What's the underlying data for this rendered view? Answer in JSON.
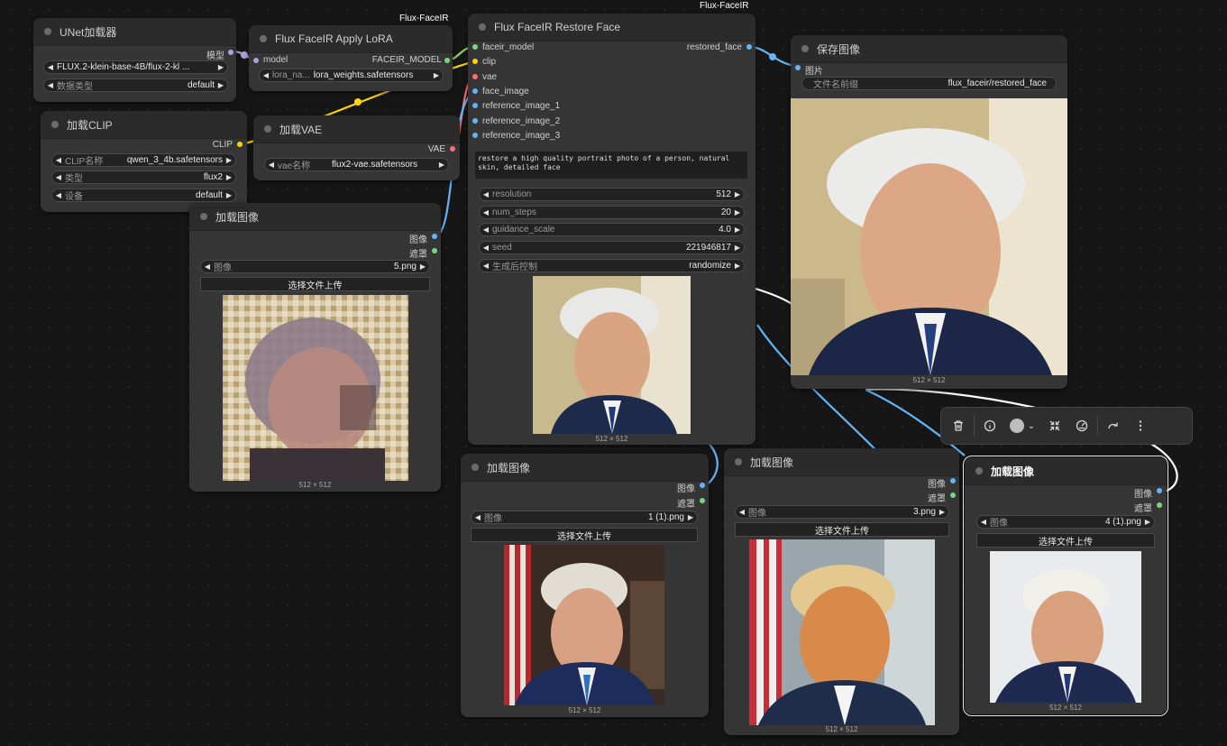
{
  "badges": {
    "lora_group": "Flux-FaceIR",
    "restore_group": "Flux-FaceIR"
  },
  "unet": {
    "title": "UNet加载器",
    "out_model": "模型",
    "unet_name": "FLUX.2-klein-base-4B/flux-2-kl ...",
    "dtype_label": "数据类型",
    "dtype_value": "default"
  },
  "lora": {
    "title": "Flux FaceIR Apply LoRA",
    "in_model": "model",
    "out_model": "FACEIR_MODEL",
    "lora_label": "lora_na...",
    "lora_value": "lora_weights.safetensors"
  },
  "clip": {
    "title": "加载CLIP",
    "out_clip": "CLIP",
    "name_label": "CLIP名称",
    "name_value": "qwen_3_4b.safetensors",
    "type_label": "类型",
    "type_value": "flux2",
    "device_label": "设备",
    "device_value": "default"
  },
  "vae": {
    "title": "加载VAE",
    "out_vae": "VAE",
    "name_label": "vae名称",
    "name_value": "flux2-vae.safetensors"
  },
  "restore": {
    "title": "Flux FaceIR Restore Face",
    "in_faceir": "faceir_model",
    "in_clip": "clip",
    "in_vae": "vae",
    "in_face": "face_image",
    "in_ref1": "reference_image_1",
    "in_ref2": "reference_image_2",
    "in_ref3": "reference_image_3",
    "out_restored": "restored_face",
    "prompt": "restore a high quality portrait photo of a person, natural skin, detailed face",
    "widgets": [
      {
        "label": "resolution",
        "value": "512"
      },
      {
        "label": "num_steps",
        "value": "20"
      },
      {
        "label": "guidance_scale",
        "value": "4.0"
      },
      {
        "label": "seed",
        "value": "221946817"
      },
      {
        "label": "生成后控制",
        "value": "randomize"
      }
    ],
    "dims": "512 × 512"
  },
  "save": {
    "title": "保存图像",
    "in_images": "图片",
    "prefix_label": "文件名前缀",
    "prefix_value": "flux_faceir/restored_face",
    "dims": "512 × 512"
  },
  "load_main": {
    "title": "加载图像",
    "out_image": "图像",
    "out_mask": "遮罩",
    "image_label": "图像",
    "image_value": "5.png",
    "upload": "选择文件上传",
    "dims": "512 × 512"
  },
  "load_1": {
    "title": "加载图像",
    "out_image": "图像",
    "out_mask": "遮罩",
    "image_label": "图像",
    "image_value": "1 (1).png",
    "upload": "选择文件上传",
    "dims": "512 × 512"
  },
  "load_3": {
    "title": "加载图像",
    "out_image": "图像",
    "out_mask": "遮罩",
    "image_label": "图像",
    "image_value": "3.png",
    "upload": "选择文件上传",
    "dims": "512 × 512"
  },
  "load_4": {
    "title": "加载图像",
    "out_image": "图像",
    "out_mask": "遮罩",
    "image_label": "图像",
    "image_value": "4 (1).png",
    "upload": "选择文件上传",
    "dims": "512 × 512"
  },
  "colors": {
    "model_wire": "#b39ddb",
    "clip_wire": "#ffd500",
    "vae_wire": "#ff6e6e",
    "image_wire": "#64b5f6",
    "output_wire": "#ffffff",
    "faceir_socket": "#7cd67c"
  },
  "toolbar_icons": [
    "trash-icon",
    "info-icon",
    "color-circle-icon",
    "chevron-down-icon",
    "collapse-icon",
    "bypass-icon",
    "redo-icon",
    "more-icon"
  ]
}
